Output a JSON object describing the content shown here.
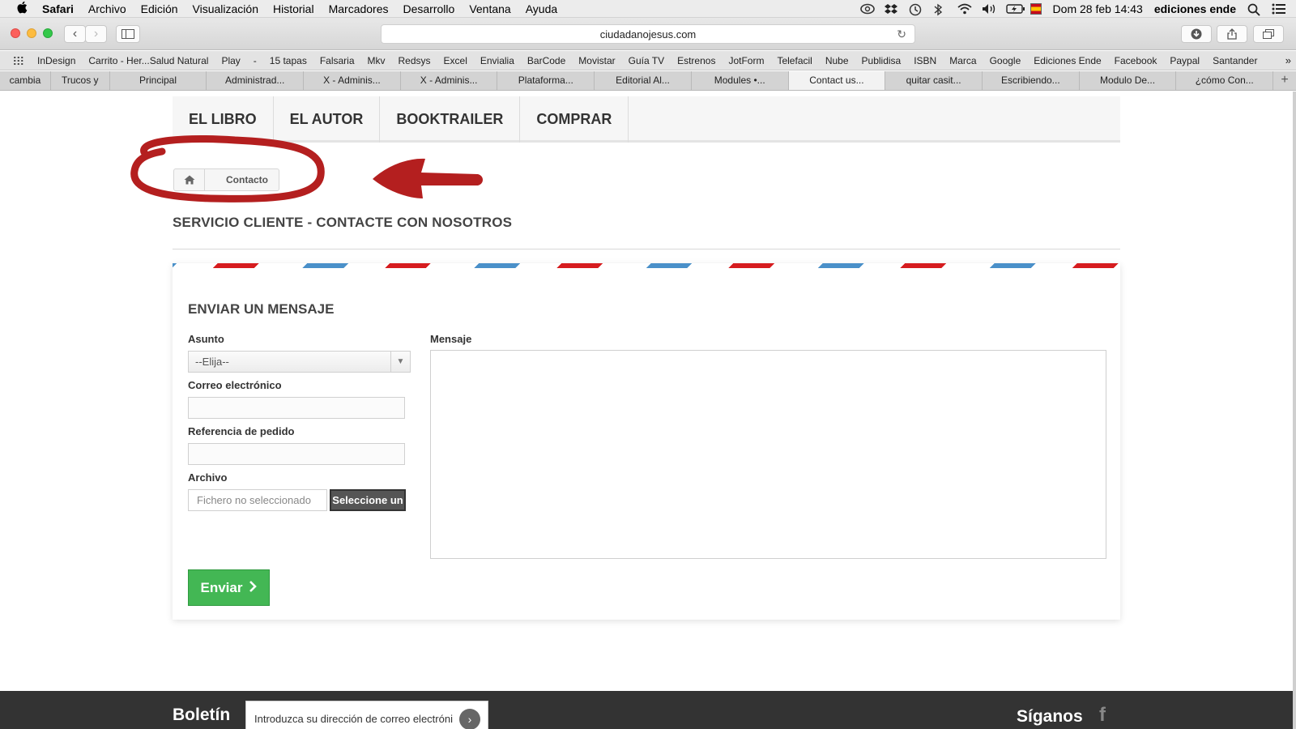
{
  "menubar": {
    "apple": "",
    "items": [
      "Safari",
      "Archivo",
      "Edición",
      "Visualización",
      "Historial",
      "Marcadores",
      "Desarrollo",
      "Ventana",
      "Ayuda"
    ],
    "clock": "Dom 28 feb  14:43",
    "user": "ediciones ende"
  },
  "toolbar": {
    "url": "ciudadanojesus.com"
  },
  "bookmarks": [
    "InDesign",
    "Carrito - Her...Salud Natural",
    "Play",
    "-",
    "15 tapas",
    "Falsaria",
    "Mkv",
    "Redsys",
    "Excel",
    "Envialia",
    "BarCode",
    "Movistar",
    "Guía TV",
    "Estrenos",
    "JotForm",
    "Telefacil",
    "Nube",
    "Publidisa",
    "ISBN",
    "Marca",
    "Google",
    "Ediciones Ende",
    "Facebook",
    "Paypal",
    "Santander"
  ],
  "tabs": [
    {
      "label": "cambia",
      "active": false
    },
    {
      "label": "Trucos y",
      "active": false
    },
    {
      "label": "Principal",
      "active": false
    },
    {
      "label": "Administrad...",
      "active": false
    },
    {
      "label": "X - Adminis...",
      "active": false
    },
    {
      "label": "X - Adminis...",
      "active": false
    },
    {
      "label": "Plataforma...",
      "active": false
    },
    {
      "label": "Editorial Al...",
      "active": false
    },
    {
      "label": "Modules •...",
      "active": false
    },
    {
      "label": "Contact us...",
      "active": true
    },
    {
      "label": "quitar casit...",
      "active": false
    },
    {
      "label": "Escribiendo...",
      "active": false
    },
    {
      "label": "Modulo De...",
      "active": false
    },
    {
      "label": "¿cómo Con...",
      "active": false
    }
  ],
  "site": {
    "nav": [
      "EL LIBRO",
      "EL AUTOR",
      "BOOKTRAILER",
      "COMPRAR"
    ],
    "breadcrumb": "Contacto",
    "page_title": "SERVICIO CLIENTE - CONTACTE CON NOSOTROS",
    "form": {
      "title": "ENVIAR UN MENSAJE",
      "subject_label": "Asunto",
      "subject_value": "--Elija--",
      "email_label": "Correo electrónico",
      "order_label": "Referencia de pedido",
      "file_label": "Archivo",
      "file_status": "Fichero no seleccionado",
      "file_button": "Seleccione un",
      "message_label": "Mensaje",
      "submit": "Enviar"
    },
    "footer": {
      "newsletter_title": "Boletín",
      "newsletter_placeholder": "Introduzca su dirección de correo electróni",
      "follow_title": "Síganos",
      "facebook_glyph": "f"
    }
  },
  "colors": {
    "annotation": "#b41f1f",
    "airmail_red": "#d61c1f",
    "airmail_blue": "#4a90c9",
    "submit_green": "#43b754",
    "footer_bg": "#333333"
  }
}
